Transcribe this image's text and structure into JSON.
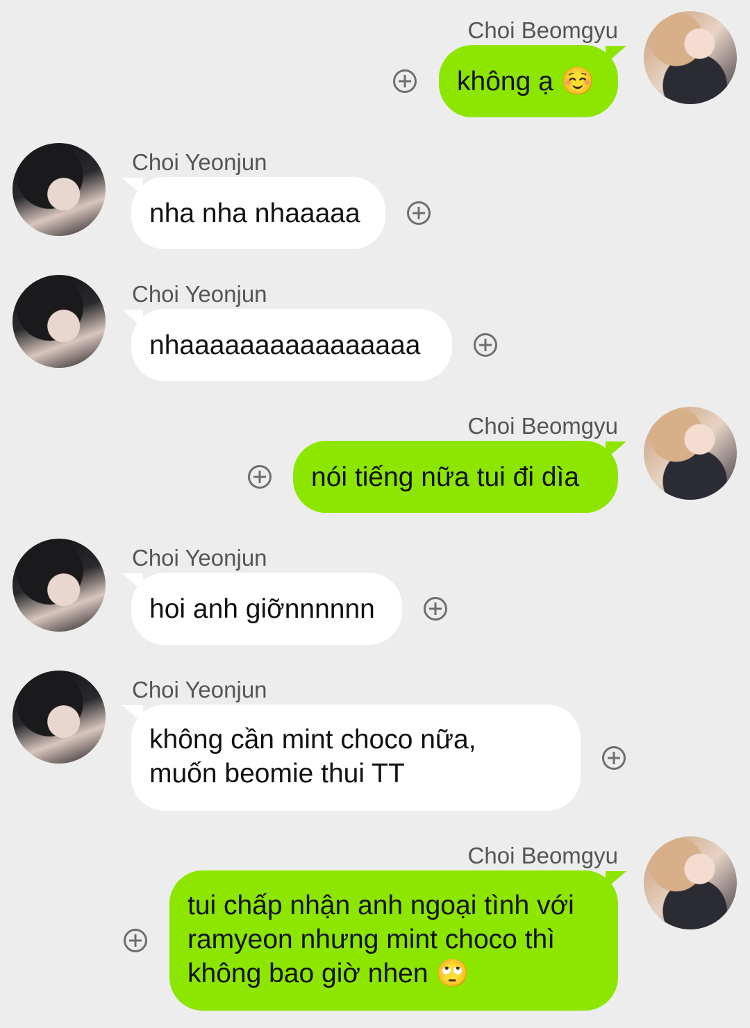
{
  "messages": [
    {
      "sender": "Choi Beomgyu",
      "text": "không ạ ☺️"
    },
    {
      "sender": "Choi Yeonjun",
      "text": "nha nha nhaaaaa"
    },
    {
      "sender": "Choi Yeonjun",
      "text": "nhaaaaaaaaaaaaaaaa"
    },
    {
      "sender": "Choi Beomgyu",
      "text": "nói tiếng nữa tui đi dìa"
    },
    {
      "sender": "Choi Yeonjun",
      "text": "hoi anh giỡnnnnnn"
    },
    {
      "sender": "Choi Yeonjun",
      "text": "không cần mint choco nữa,\nmuốn beomie thui TT"
    },
    {
      "sender": "Choi Beomgyu",
      "text": "tui chấp nhận anh ngoại tình với\nramyeon nhưng mint choco thì\nkhông bao giờ nhen 🙄"
    }
  ],
  "icons": {
    "add": "plus-circle-icon",
    "avatar_beomgyu": "profile-photo",
    "avatar_yeonjun": "profile-photo"
  },
  "colors": {
    "background": "#ededed",
    "outgoing_bubble": "#8de600",
    "incoming_bubble": "#ffffff"
  }
}
